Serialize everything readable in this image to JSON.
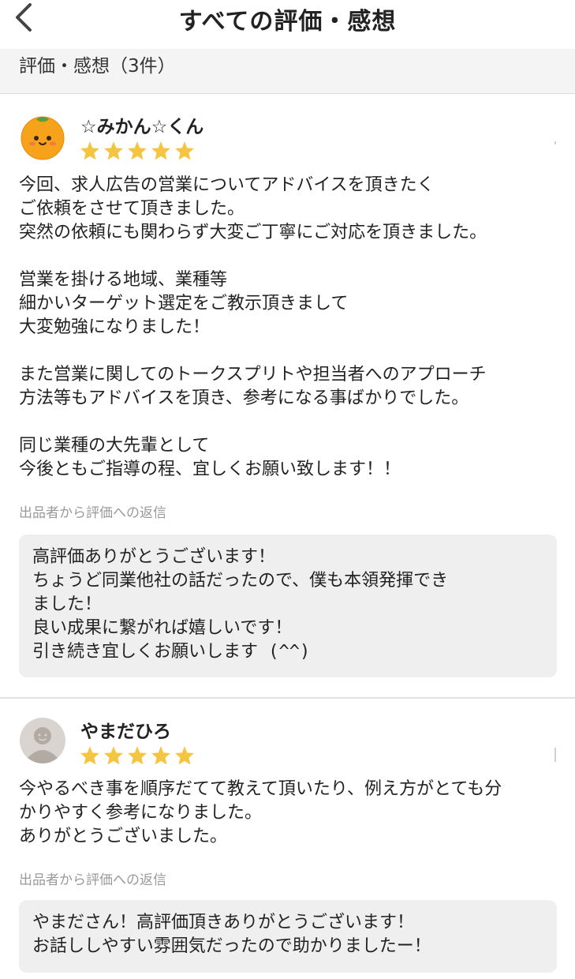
{
  "header": {
    "title": "すべての評価・感想"
  },
  "section": {
    "title": "評価・感想（3件）"
  },
  "reviews": [
    {
      "reviewer": "☆みかん☆くん",
      "avatar": "orange-character-icon",
      "rating": 5,
      "body": "今回、求人広告の営業についてアドバイスを頂きたく\nご依頼をさせて頂きました。\n突然の依頼にも関わらず大変ご丁寧にご対応を頂きました。\n\n営業を掛ける地域、業種等\n細かいターゲット選定をご教示頂きまして\n大変勉強になりました！\n\nまた営業に関してのトークスプリトや担当者へのアプローチ\n方法等もアドバイスを頂き、参考になる事ばかりでした。\n\n同じ業種の大先輩として\n今後ともご指導の程、宜しくお願い致します！！",
      "reply_label": "出品者から評価への返信",
      "reply": "高評価ありがとうございます！\nちょうど同業他社の話だったので、僕も本領発揮でき\nました！\n良い成果に繋がれば嬉しいです！\n引き続き宜しくお願いします (^^)"
    },
    {
      "reviewer": "やまだひろ",
      "avatar": "default-user-icon",
      "rating": 5,
      "body": "今やるべき事を順序だてて教えて頂いたり、例え方がとても分\nかりやすく参考になりました。\nありがとうございました。",
      "reply_label": "出品者から評価への返信",
      "reply": "やまださん！高評価頂きありがとうございます！\nお話ししやすい雰囲気だったので助かりましたー！"
    }
  ],
  "colors": {
    "star": "#f5c542",
    "reply_bg": "#efefef",
    "section_bg": "#f4f4f4"
  }
}
